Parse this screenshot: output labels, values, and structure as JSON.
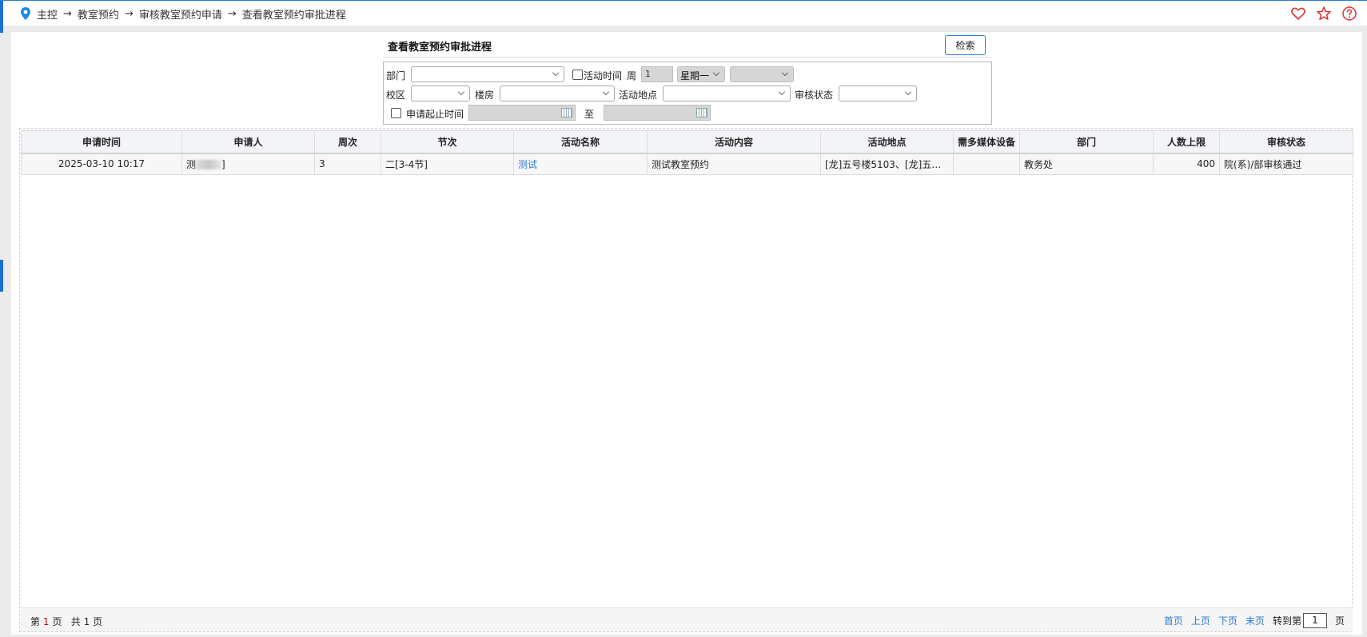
{
  "breadcrumb": {
    "items": [
      "主控",
      "教室预约",
      "审核教室预约申请",
      "查看教室预约审批进程"
    ],
    "arrow": "→"
  },
  "header": {
    "title": "查看教室预约审批进程",
    "search_label": "检索"
  },
  "filters": {
    "dept_label": "部门",
    "activity_time_label": "活动时间",
    "week_label": "周",
    "week_value": "1",
    "weekday_value": "星期一",
    "campus_label": "校区",
    "building_label": "楼房",
    "location_label": "活动地点",
    "status_label": "审核状态",
    "apply_range_label": "申请起止时间",
    "to_label": "至"
  },
  "table": {
    "columns": [
      "申请时间",
      "申请人",
      "周次",
      "节次",
      "活动名称",
      "活动内容",
      "活动地点",
      "需多媒体设备",
      "部门",
      "人数上限",
      "审核状态"
    ],
    "rows": [
      {
        "apply_time": "2025-03-10 10:17",
        "applicant_prefix": "测",
        "applicant_suffix": "]",
        "week": "3",
        "period": "二[3-4节]",
        "activity_name": "测试",
        "activity_content": "测试教室预约",
        "location": "[龙]五号楼5103、[龙]五号...",
        "multimedia": "",
        "department": "教务处",
        "capacity": "400",
        "status": "院(系)/部审核通过"
      }
    ]
  },
  "pager": {
    "prefix": "第",
    "current": "1",
    "page_unit": "页",
    "total_prefix": "共",
    "total": "1",
    "first": "首页",
    "prev": "上页",
    "next": "下页",
    "last": "末页",
    "goto_label": "转到第",
    "goto_value": "1",
    "goto_suffix": "页"
  },
  "icons": {
    "location": "location-pin-icon",
    "favorite": "heart-icon",
    "star": "star-icon",
    "help": "help-icon"
  },
  "colors": {
    "accent": "#2b7cd3",
    "pin": "#1e88e5",
    "icon_red": "#e0302f",
    "current_page": "#d0021b"
  }
}
